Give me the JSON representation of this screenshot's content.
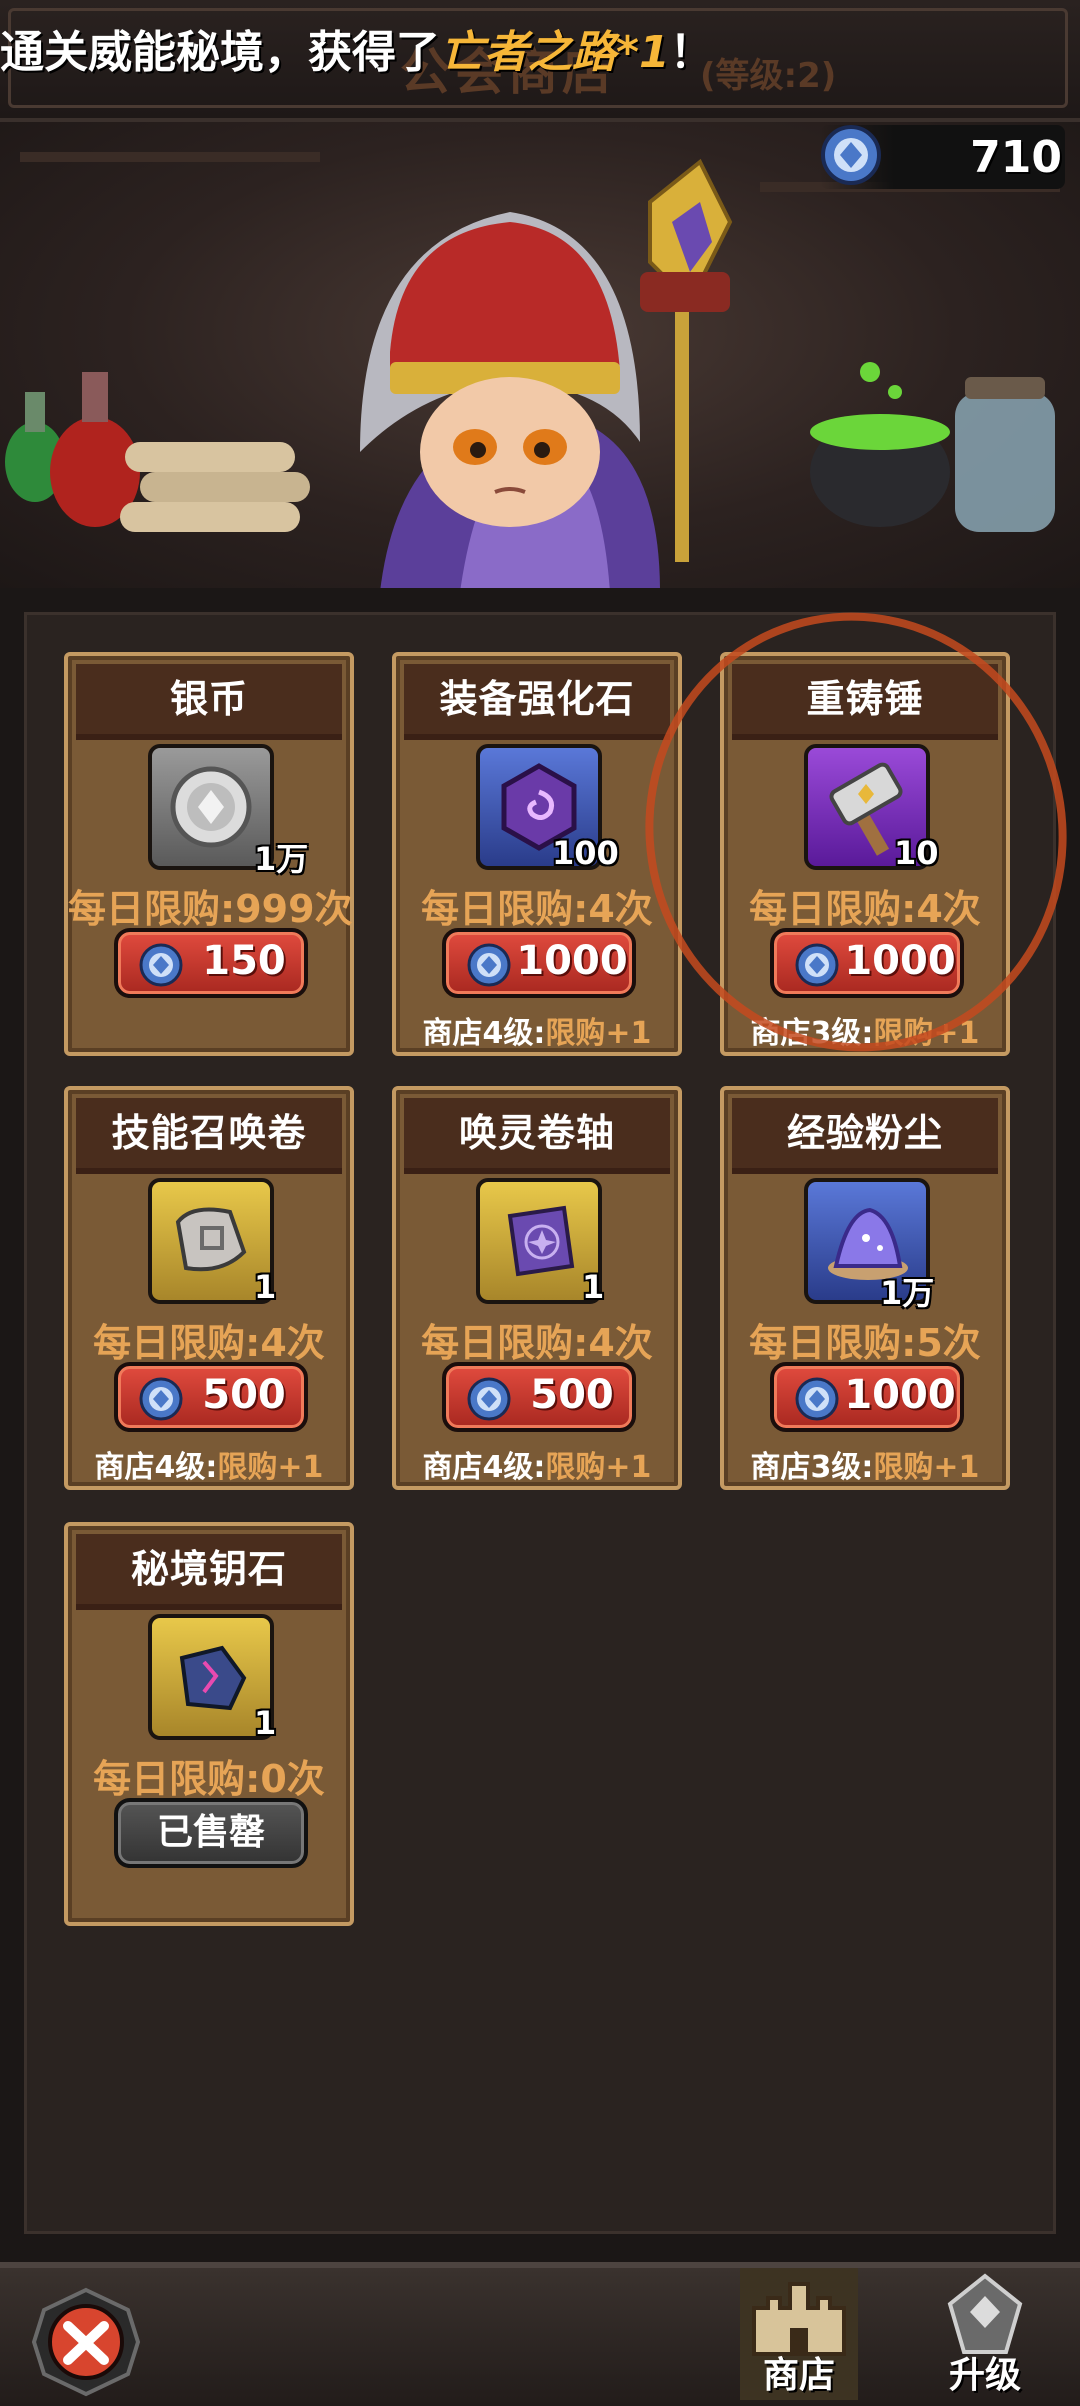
{
  "header": {
    "notice_prefix": "通关威能秘境，获得了",
    "notice_highlight": "亡者之路*1",
    "notice_suffix": "！",
    "shop_title": "公会商店",
    "shop_level": "(等级:2)"
  },
  "currency": {
    "icon": "blue-coin-icon",
    "value": "710"
  },
  "items": [
    {
      "name": "银币",
      "icon": "silver-coin-icon",
      "qty": "1万",
      "limit": "每日限购:999次",
      "price": "150",
      "bonus_prefix": "",
      "bonus": ""
    },
    {
      "name": "装备强化石",
      "icon": "enhance-stone-icon",
      "qty": "100",
      "limit": "每日限购:4次",
      "price": "1000",
      "bonus_prefix": "商店4级:",
      "bonus": "限购+1"
    },
    {
      "name": "重铸锤",
      "icon": "hammer-icon",
      "qty": "10",
      "limit": "每日限购:4次",
      "price": "1000",
      "bonus_prefix": "商店3级:",
      "bonus": "限购+1"
    },
    {
      "name": "技能召唤卷",
      "icon": "skill-scroll-icon",
      "qty": "1",
      "limit": "每日限购:4次",
      "price": "500",
      "bonus_prefix": "商店4级:",
      "bonus": "限购+1"
    },
    {
      "name": "唤灵卷轴",
      "icon": "summon-scroll-icon",
      "qty": "1",
      "limit": "每日限购:4次",
      "price": "500",
      "bonus_prefix": "商店4级:",
      "bonus": "限购+1"
    },
    {
      "name": "经验粉尘",
      "icon": "exp-dust-icon",
      "qty": "1万",
      "limit": "每日限购:5次",
      "price": "1000",
      "bonus_prefix": "商店3级:",
      "bonus": "限购+1"
    },
    {
      "name": "秘境钥石",
      "icon": "key-stone-icon",
      "qty": "1",
      "limit": "每日限购:0次",
      "sold_label": "已售罄",
      "bonus_prefix": "",
      "bonus": ""
    }
  ],
  "nav": {
    "back_icon": "close-icon",
    "shop": "商店",
    "upgrade": "升级"
  },
  "colors": {
    "accent": "#e6a456",
    "button": "#d23a30",
    "card": "#7a5a36",
    "annotation": "#c44a1e"
  }
}
